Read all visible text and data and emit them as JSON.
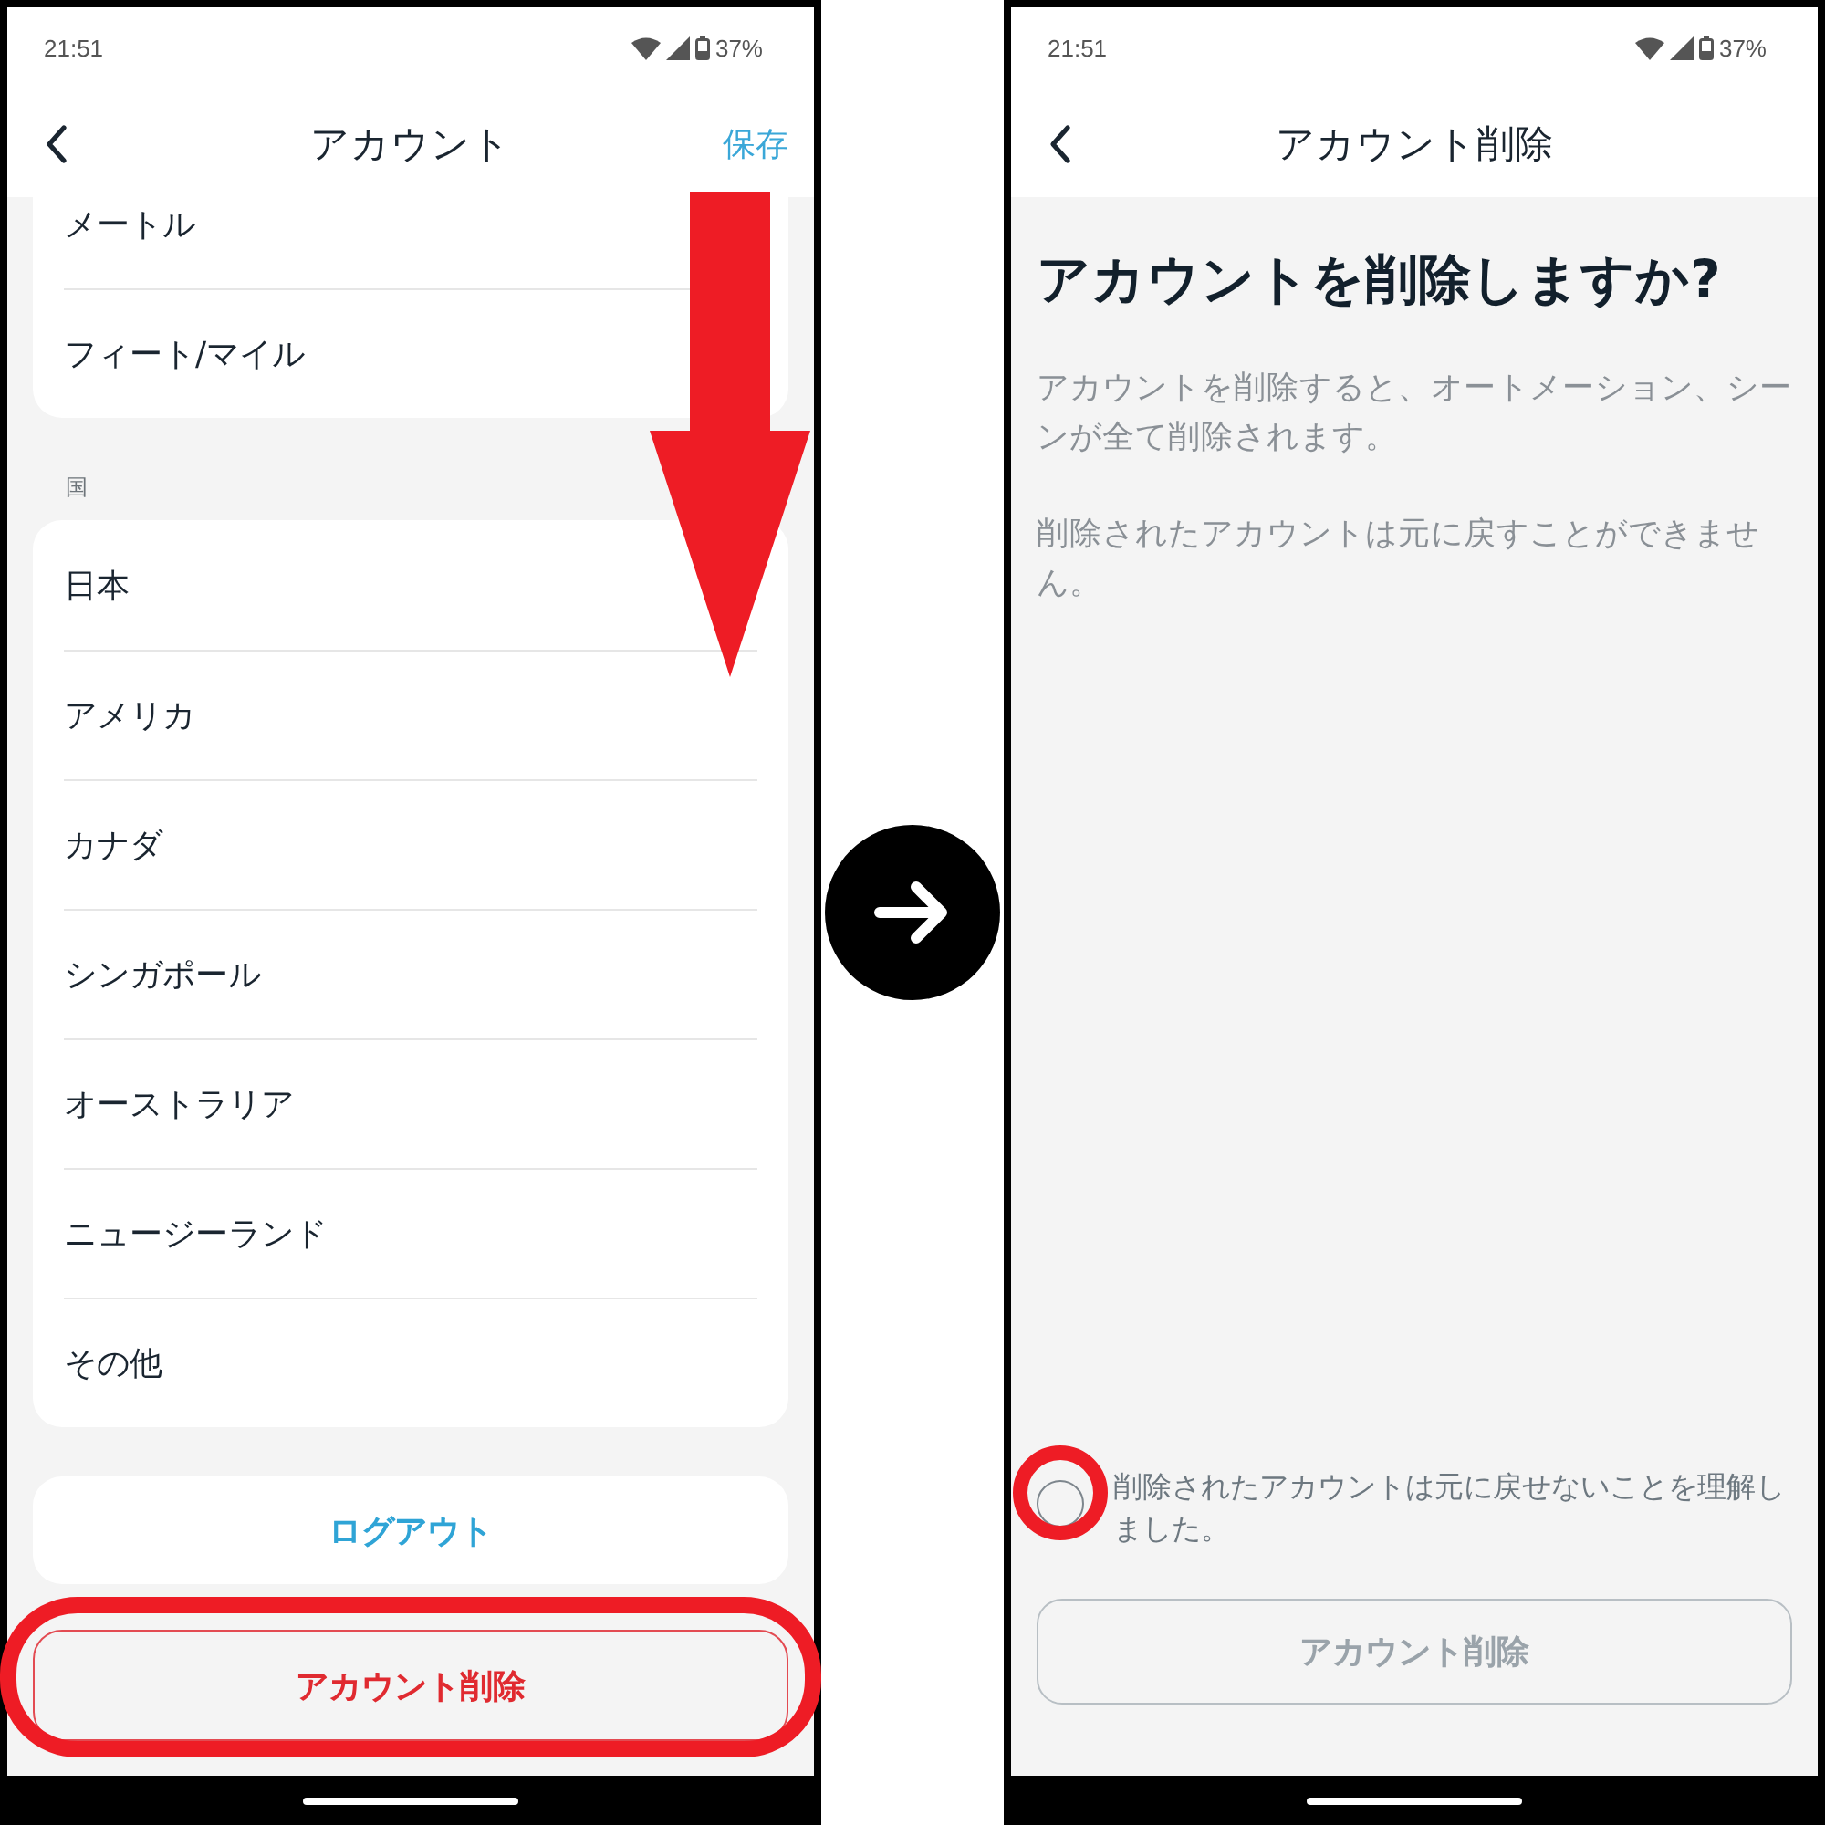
{
  "account_screen": {
    "status_bar": {
      "time": "21:51",
      "battery": "37%"
    },
    "header": {
      "title": "アカウント",
      "action": "保存"
    },
    "unit_options": [
      "メートル",
      "フィート/マイル"
    ],
    "country_section": {
      "label": "国",
      "options": [
        "日本",
        "アメリカ",
        "カナダ",
        "シンガポール",
        "オーストラリア",
        "ニュージーランド",
        "その他"
      ]
    },
    "logout_button": "ログアウト",
    "delete_button": "アカウント削除"
  },
  "delete_screen": {
    "status_bar": {
      "time": "21:51",
      "battery": "37%"
    },
    "header": {
      "title": "アカウント削除"
    },
    "heading": "アカウントを削除しますか?",
    "paragraphs": [
      "アカウントを削除すると、オートメーション、シーンが全て削除されます。",
      "削除されたアカウントは元に戻すことができません。"
    ],
    "confirm": {
      "label": "削除されたアカウントは元に戻せないことを理解しました。",
      "checked": false
    },
    "delete_button": {
      "label": "アカウント削除",
      "disabled": true
    }
  }
}
